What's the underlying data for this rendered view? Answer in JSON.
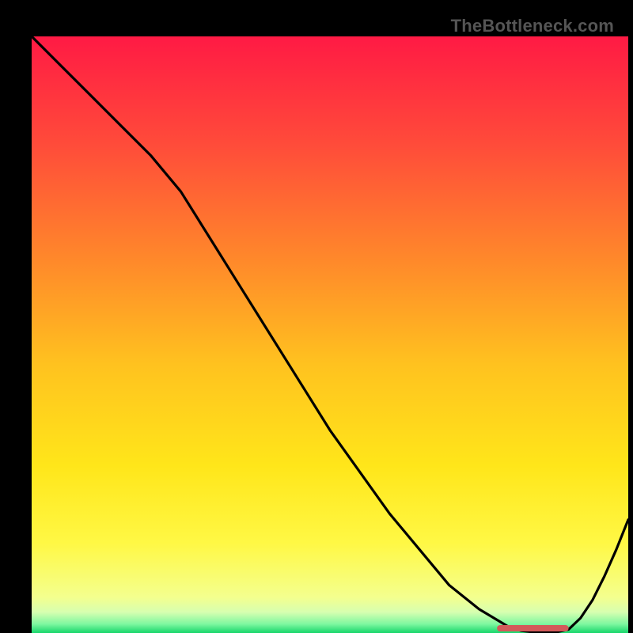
{
  "watermark": "TheBottleneck.com",
  "chart_data": {
    "type": "line",
    "title": "",
    "xlabel": "",
    "ylabel": "",
    "xlim": [
      0,
      100
    ],
    "ylim": [
      0,
      100
    ],
    "series": [
      {
        "name": "curve",
        "x": [
          0,
          5,
          10,
          15,
          20,
          25,
          30,
          35,
          40,
          45,
          50,
          55,
          60,
          65,
          70,
          75,
          80,
          82,
          84,
          86,
          88,
          90,
          92,
          94,
          96,
          98,
          100
        ],
        "y": [
          100,
          95,
          90,
          85,
          80,
          74,
          66,
          58,
          50,
          42,
          34,
          27,
          20,
          14,
          8,
          4,
          1,
          0.4,
          0.15,
          0.08,
          0.15,
          0.6,
          2.5,
          5.5,
          9.5,
          14,
          19
        ]
      }
    ],
    "highlight_segment": {
      "x_start": 78,
      "x_end": 90,
      "color": "#d35a5a"
    },
    "gradient_stops": [
      {
        "offset": 0.0,
        "color": "#ff1a44"
      },
      {
        "offset": 0.18,
        "color": "#ff4b3a"
      },
      {
        "offset": 0.38,
        "color": "#ff8a2a"
      },
      {
        "offset": 0.55,
        "color": "#ffc21f"
      },
      {
        "offset": 0.72,
        "color": "#ffe61a"
      },
      {
        "offset": 0.85,
        "color": "#fff845"
      },
      {
        "offset": 0.94,
        "color": "#f4ff8e"
      },
      {
        "offset": 0.965,
        "color": "#d7ffb0"
      },
      {
        "offset": 0.985,
        "color": "#7ef7a0"
      },
      {
        "offset": 1.0,
        "color": "#17d66b"
      }
    ]
  }
}
